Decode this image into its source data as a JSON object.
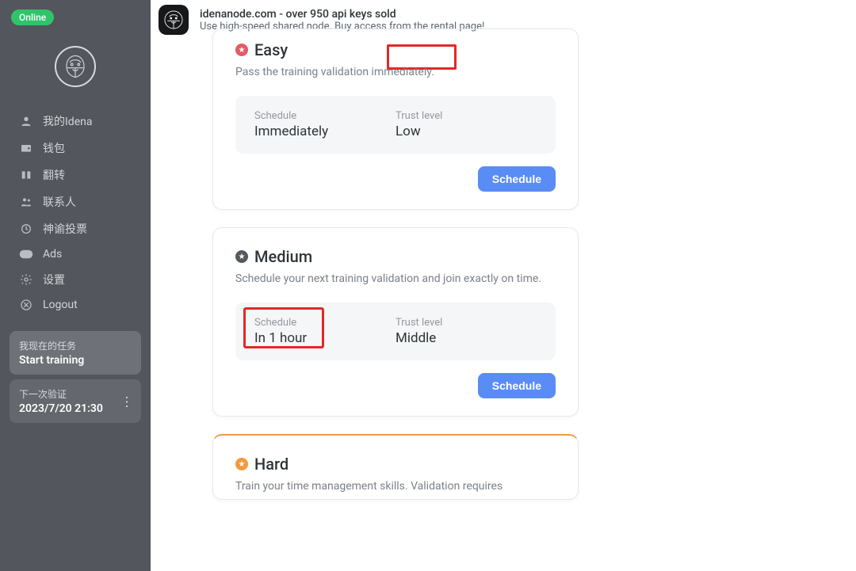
{
  "sidebar": {
    "status": "Online",
    "nav": [
      {
        "label": "我的Idena"
      },
      {
        "label": "钱包"
      },
      {
        "label": "翻转"
      },
      {
        "label": "联系人"
      },
      {
        "label": "神谕投票"
      },
      {
        "label": "Ads"
      },
      {
        "label": "设置"
      },
      {
        "label": "Logout"
      }
    ],
    "task1_label": "我现在的任务",
    "task1_main": "Start training",
    "task2_label": "下一次验证",
    "task2_main": "2023/7/20 21:30"
  },
  "banner": {
    "title": "idenanode.com - over 950 api keys sold",
    "subtitle": "Use high-speed shared node. Buy access from the rental page!"
  },
  "cards": {
    "easy": {
      "title": "Easy",
      "desc": "Pass the training validation immediately.",
      "schedule_label": "Schedule",
      "schedule_value": "Immediately",
      "trust_label": "Trust level",
      "trust_value": "Low",
      "button": "Schedule",
      "star_color": "#e55a66"
    },
    "medium": {
      "title": "Medium",
      "desc": "Schedule your next training validation and join exactly on time.",
      "schedule_label": "Schedule",
      "schedule_value": "In 1 hour",
      "trust_label": "Trust level",
      "trust_value": "Middle",
      "button": "Schedule",
      "star_color": "#555a60"
    },
    "hard": {
      "title": "Hard",
      "desc": "Train your time management skills. Validation requires",
      "star_color": "#f29a3f"
    }
  }
}
